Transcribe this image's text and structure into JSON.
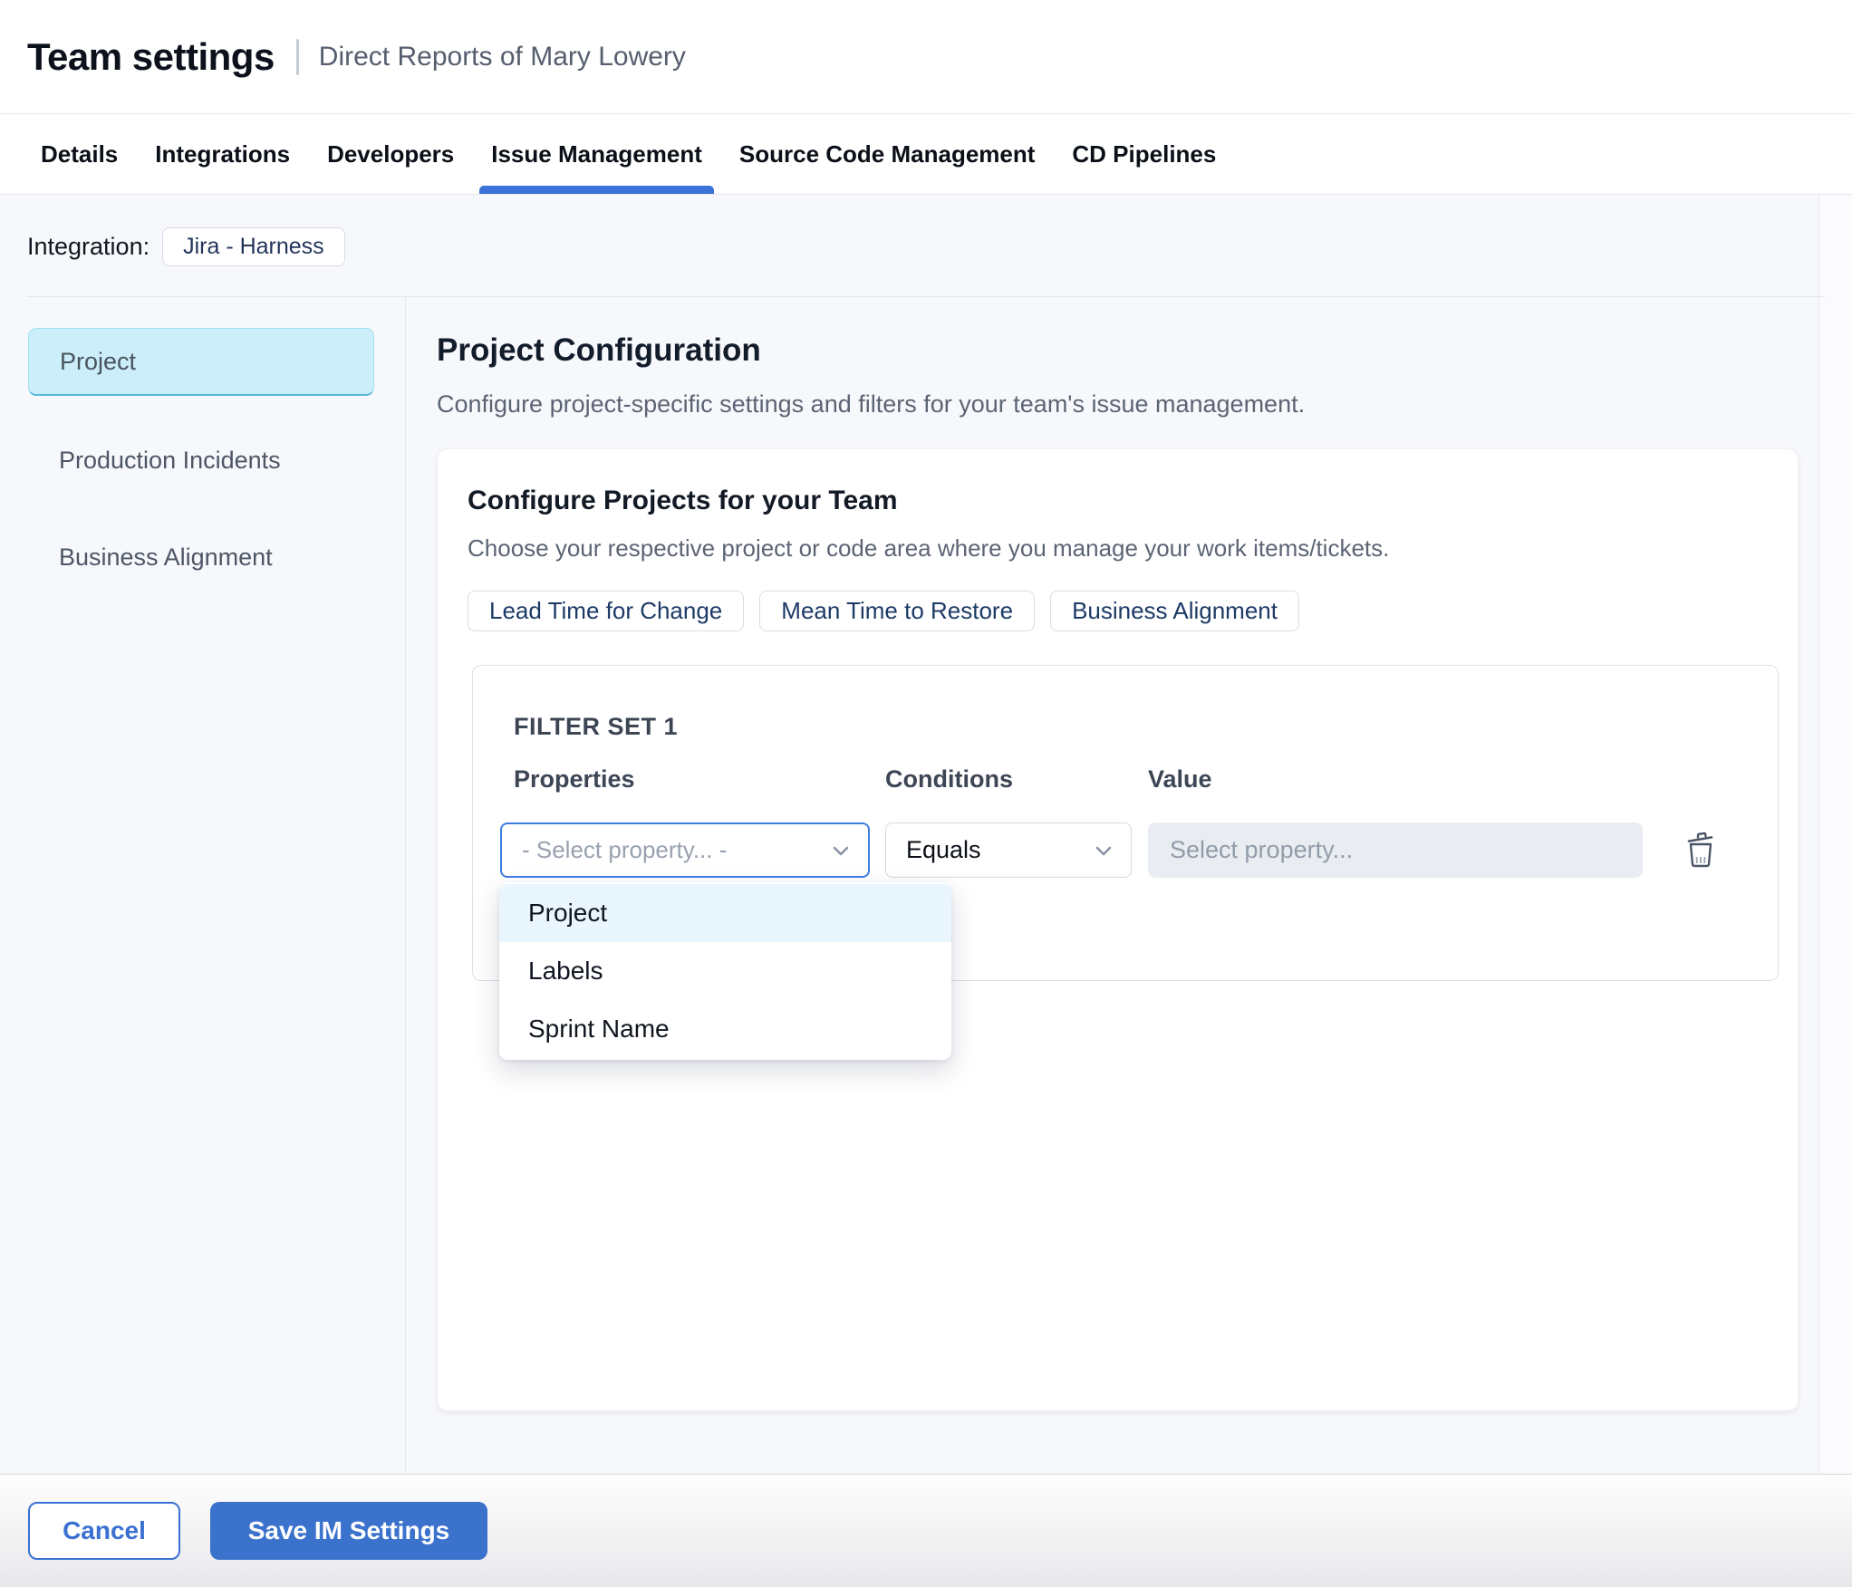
{
  "header": {
    "title": "Team settings",
    "subtitle": "Direct Reports of Mary Lowery",
    "tabs": [
      {
        "label": "Details",
        "active": false
      },
      {
        "label": "Integrations",
        "active": false
      },
      {
        "label": "Developers",
        "active": false
      },
      {
        "label": "Issue Management",
        "active": true
      },
      {
        "label": "Source Code Management",
        "active": false
      },
      {
        "label": "CD Pipelines",
        "active": false
      }
    ]
  },
  "integration": {
    "label": "Integration:",
    "chip": "Jira - Harness"
  },
  "sidebar": {
    "items": [
      {
        "label": "Project",
        "active": true
      },
      {
        "label": "Production Incidents",
        "active": false
      },
      {
        "label": "Business Alignment",
        "active": false
      }
    ]
  },
  "main": {
    "heading": "Project Configuration",
    "description": "Configure project-specific settings and filters for your team's issue management.",
    "card": {
      "heading": "Configure Projects for your Team",
      "description": "Choose your respective project or code area where you manage your work items/tickets.",
      "metric_chips": [
        "Lead Time for Change",
        "Mean Time to Restore",
        "Business Alignment"
      ],
      "filter_set": {
        "title": "FILTER SET 1",
        "columns": [
          "Properties",
          "Conditions",
          "Value"
        ],
        "property_placeholder": "- Select property... -",
        "condition_value": "Equals",
        "value_placeholder": "Select property...",
        "icons": [
          "chevron-down-icon",
          "chevron-down-icon",
          "trash-icon"
        ]
      },
      "dropdown": {
        "options": [
          {
            "label": "Project",
            "highlighted": true
          },
          {
            "label": "Labels",
            "highlighted": false
          },
          {
            "label": "Sprint Name",
            "highlighted": false
          }
        ]
      }
    }
  },
  "footer": {
    "cancel_label": "Cancel",
    "save_label": "Save IM Settings"
  },
  "colors": {
    "accent_blue": "#3a72cc",
    "tab_underline": "#3b72d8",
    "focus_border": "#3e7ce2",
    "sidebar_active_bg": "#cbeefa",
    "sidebar_active_border": "#59b9db",
    "dropdown_highlight": "#e9f6fd",
    "content_bg": "#f7f8fb",
    "chip_text": "#1d3a66"
  }
}
